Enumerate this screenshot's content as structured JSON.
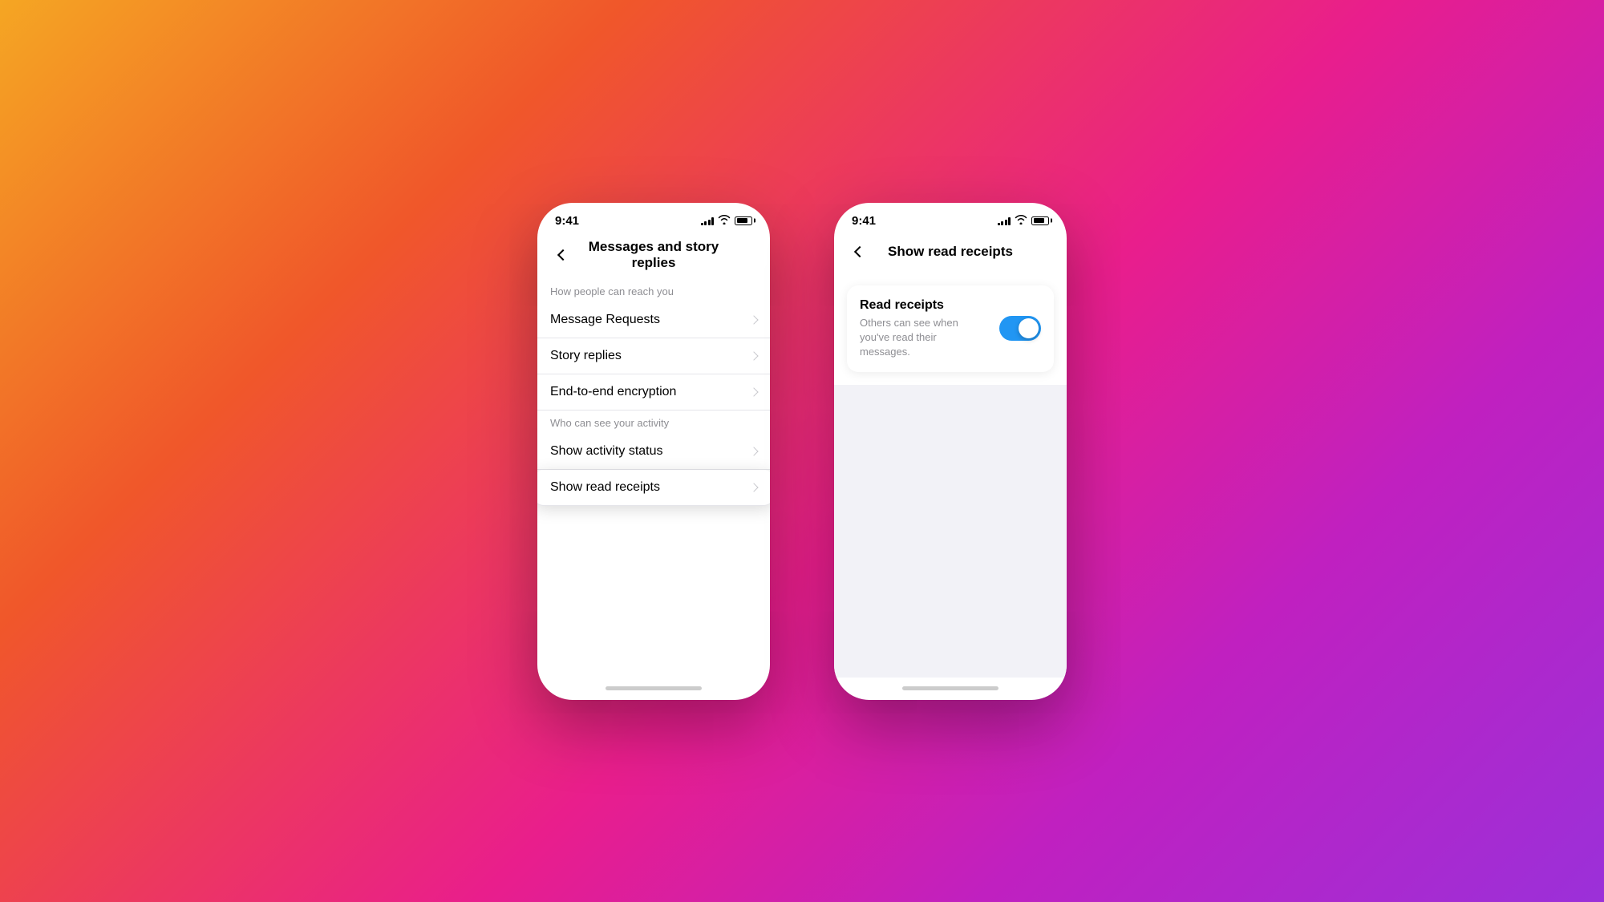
{
  "background": {
    "gradient": "linear-gradient(135deg, #f5a623 0%, #f0572a 25%, #e91e8c 55%, #c020c0 75%, #9b30d9 100%)"
  },
  "phone1": {
    "status_bar": {
      "time": "9:41",
      "battery_level": 80
    },
    "nav": {
      "back_label": "back",
      "title": "Messages and story replies"
    },
    "sections": [
      {
        "header": "How people can reach you",
        "items": [
          {
            "label": "Message Requests",
            "has_chevron": true
          },
          {
            "label": "Story replies",
            "has_chevron": true
          },
          {
            "label": "End-to-end encryption",
            "has_chevron": true
          }
        ]
      },
      {
        "header": "Who can see your activity",
        "items": [
          {
            "label": "Show activity status",
            "has_chevron": true
          },
          {
            "label": "Show read receipts",
            "has_chevron": true,
            "highlighted": true
          }
        ]
      }
    ]
  },
  "phone2": {
    "status_bar": {
      "time": "9:41",
      "battery_level": 80
    },
    "nav": {
      "back_label": "back",
      "title": "Show read receipts"
    },
    "card": {
      "title": "Read receipts",
      "description": "Others can see when you've read their messages.",
      "toggle_on": true
    }
  }
}
